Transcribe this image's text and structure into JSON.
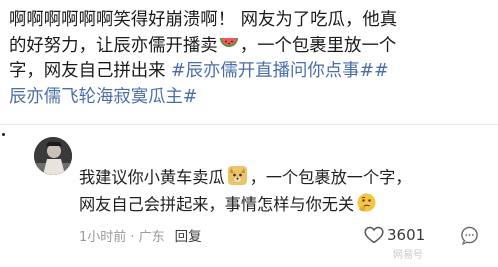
{
  "post": {
    "line1": "啊啊啊啊啊啊笑得好崩溃啊！ 网友为了吃瓜，他真",
    "line2_part1": "的好努力，让辰亦儒开播卖",
    "line2_emoji": "watermelon-emoji",
    "line2_part2": "，一个包裹里放一个",
    "line3_part1": "字，网友自己拼出来 ",
    "line3_tag": "#辰亦儒开直播问你点事##",
    "line4_tag": "辰亦儒飞轮海寂寞瓜主#"
  },
  "comment": {
    "avatar": "avatar-photo",
    "line1_part1": "我建议你小黄车卖瓜",
    "line1_emoji": "doge-emoji",
    "line1_part2": "，一个包裹放一个字，",
    "line2_part1": "网友自己会拼起来，事情怎样与你无关",
    "line2_emoji": "thinking-emoji",
    "time_location": "1小时前 · 广东",
    "reply_label": "回复",
    "like_icon": "heart-outline-icon",
    "like_count": "3601",
    "more_icon": "comment-bubble-icon",
    "watermark": "网易号"
  },
  "colors": {
    "hashtag": "#4a6ea8",
    "meta_text": "#9a9a9a",
    "divider": "#e6e6e6"
  }
}
